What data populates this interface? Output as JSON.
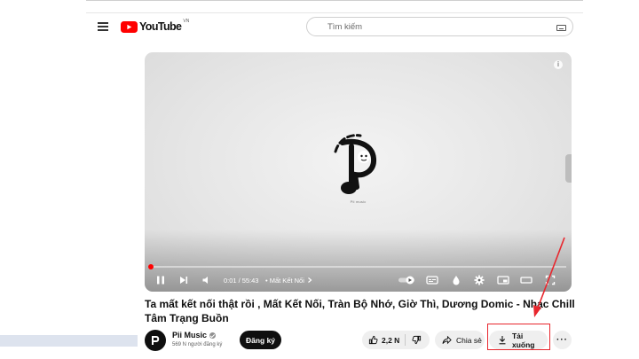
{
  "header": {
    "logo_text": "YouTube",
    "logo_region": "VN",
    "search_placeholder": "Tìm kiếm"
  },
  "player": {
    "channel_logo_caption": "Pii music",
    "progress_fraction": 0.003,
    "current_time": "0:01",
    "time_separator": "/",
    "duration": "55:43",
    "chapter": "• Mất Kết Nối",
    "info_icon": "i"
  },
  "video": {
    "title": "Ta mất kết nối thật rồi , Mất Kết Nối, Tràn Bộ Nhớ, Giờ Thì, Dương Domic - Nhạc Chill Tâm Trạng Buồn"
  },
  "channel": {
    "name": "Pii Music",
    "subscribers": "569 N người đăng ký",
    "subscribe_label": "Đăng ký"
  },
  "actions": {
    "like_count": "2,2 N",
    "share_label": "Chia sẻ",
    "download_label": "Tải xuống",
    "more_label": "···"
  },
  "annotation": {
    "color": "#e8262d"
  },
  "colors": {
    "brand_red": "#ff0000",
    "subscribe_bg": "#0f0f0f",
    "pill_bg": "#efefef"
  },
  "icons": {
    "menu": "hamburger-icon",
    "logo": "youtube-play-icon",
    "keyboard": "keyboard-icon",
    "play_pause": "pause-icon",
    "next": "next-icon",
    "volume": "volume-icon",
    "autoplay": "autoplay-toggle-icon",
    "captions": "subtitles-icon",
    "ambient": "ambient-mode-icon",
    "settings": "gear-icon",
    "miniplayer": "miniplayer-icon",
    "theater": "theater-mode-icon",
    "fullscreen": "fullscreen-icon",
    "like": "thumb-up-icon",
    "dislike": "thumb-down-icon",
    "share": "share-icon",
    "download": "download-icon"
  }
}
